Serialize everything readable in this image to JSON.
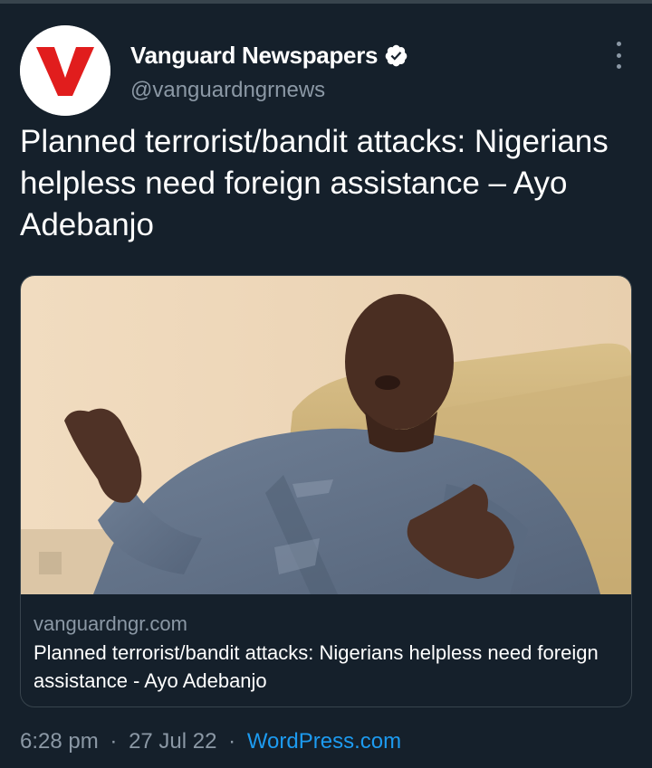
{
  "tweet": {
    "author": {
      "name": "Vanguard Newspapers",
      "handle": "@vanguardngrnews",
      "verified": true,
      "avatar_letter": "V"
    },
    "text": "Planned terrorist/bandit attacks: Nigerians helpless need foreign assistance – Ayo Adebanjo",
    "card": {
      "domain": "vanguardngr.com",
      "title": "Planned terrorist/bandit attacks: Nigerians helpless need foreign assistance - Ayo Adebanjo"
    },
    "meta": {
      "time": "6:28 pm",
      "separator": "·",
      "date": "27 Jul 22",
      "source": "WordPress.com"
    }
  },
  "icons": {
    "verified": "verified-badge-icon",
    "more": "more-vertical-icon"
  },
  "colors": {
    "background": "#15202b",
    "primary_text": "#ffffff",
    "secondary_text": "#8b98a5",
    "link": "#1d9bf0",
    "border": "#38444d",
    "brand_red": "#e11d1d"
  }
}
